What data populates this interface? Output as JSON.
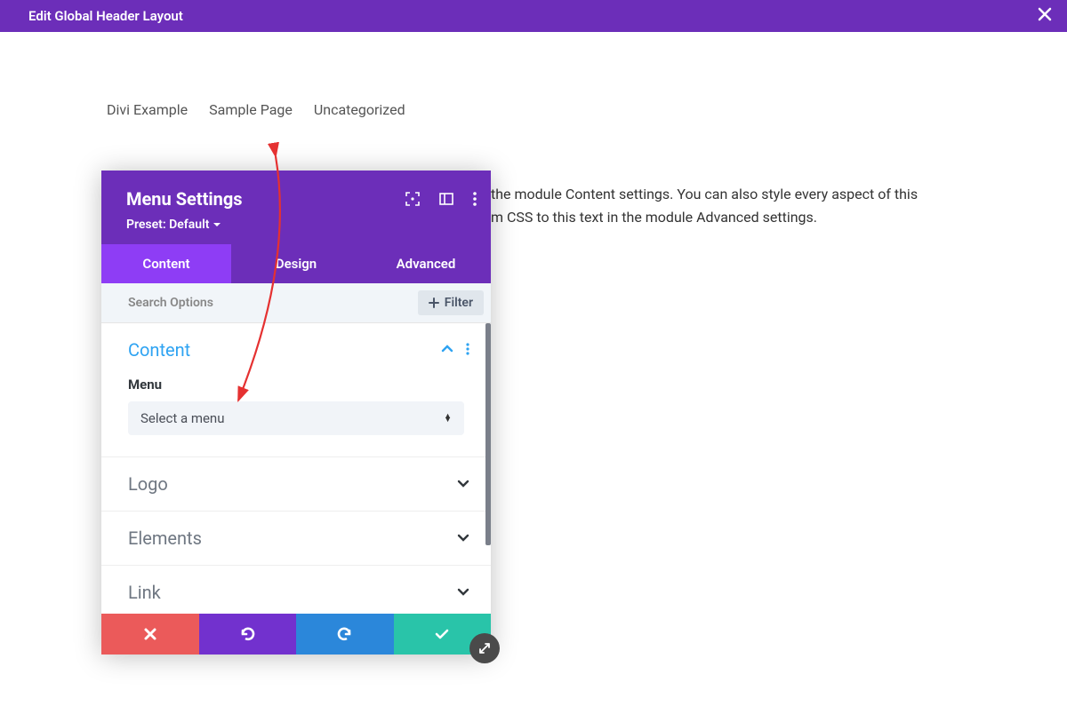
{
  "topbar": {
    "title": "Edit Global Header Layout"
  },
  "nav": {
    "items": [
      "Divi Example",
      "Sample Page",
      "Uncategorized"
    ]
  },
  "body_text": {
    "line1": "the module Content settings. You can also style every aspect of this",
    "line2": "m CSS to this text in the module Advanced settings."
  },
  "panel": {
    "title": "Menu Settings",
    "preset_label": "Preset: Default",
    "tabs": {
      "content": "Content",
      "design": "Design",
      "advanced": "Advanced"
    },
    "search_placeholder": "Search Options",
    "filter_label": "Filter",
    "sections": {
      "content": {
        "title": "Content",
        "menu_label": "Menu",
        "menu_select_value": "Select a menu"
      },
      "logo": "Logo",
      "elements": "Elements",
      "link": "Link"
    }
  }
}
